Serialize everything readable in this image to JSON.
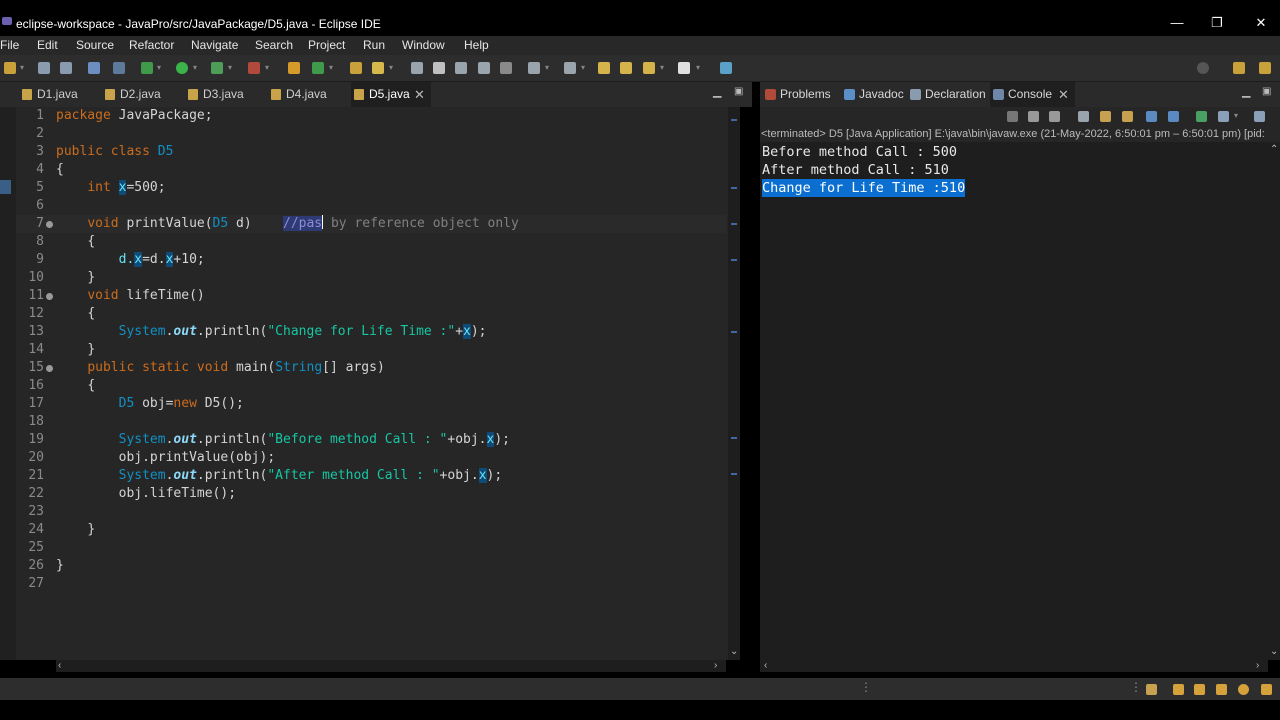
{
  "window": {
    "title": "eclipse-workspace - JavaPro/src/JavaPackage/D5.java - Eclipse IDE",
    "controls": {
      "minimize": "—",
      "maximize": "❐",
      "close": "✕"
    }
  },
  "menu": [
    "File",
    "Edit",
    "Source",
    "Refactor",
    "Navigate",
    "Search",
    "Project",
    "Run",
    "Window",
    "Help"
  ],
  "editor_tabs": [
    {
      "label": "D1.java",
      "active": false
    },
    {
      "label": "D2.java",
      "active": false
    },
    {
      "label": "D3.java",
      "active": false
    },
    {
      "label": "D4.java",
      "active": false
    },
    {
      "label": "D5.java",
      "active": true,
      "close": "✕"
    }
  ],
  "editor": {
    "line_numbers": [
      "1",
      "2",
      "3",
      "4",
      "5",
      "6",
      "7",
      "8",
      "9",
      "10",
      "11",
      "12",
      "13",
      "14",
      "15",
      "16",
      "17",
      "18",
      "19",
      "20",
      "21",
      "22",
      "23",
      "24",
      "25",
      "26",
      "27"
    ],
    "code": {
      "l1_kw": "package",
      "l1_rest": " JavaPackage;",
      "l3_kw1": "public",
      "l3_kw2": "class",
      "l3_name": "D5",
      "l4": "{",
      "l5_kw": "int",
      "l5_field": "x",
      "l5_rest": "=500;",
      "l7_kw": "void",
      "l7_m": " printValue(",
      "l7_type": "D5",
      "l7_param": " d)",
      "l7_comment_a": "//pas",
      "l7_comment_b": " by reference object only",
      "l8": "{",
      "l9_a": "d.",
      "l9_x1": "x",
      "l9_b": "=d.",
      "l9_x2": "x",
      "l9_c": "+10;",
      "l10": "}",
      "l11_kw": "void",
      "l11_rest": " lifeTime()",
      "l12": "{",
      "l13_sys": "System",
      "l13_dot": ".",
      "l13_out": "out",
      "l13_pr": ".println(",
      "l13_str": "\"Change for Life Time :\"",
      "l13_plus": "+",
      "l13_x": "x",
      "l13_end": ");",
      "l14": "}",
      "l15_kw1": "public",
      "l15_kw2": "static",
      "l15_kw3": "void",
      "l15_main": " main(",
      "l15_type": "String",
      "l15_rest": "[] args)",
      "l16": "{",
      "l17_type": "D5",
      "l17_a": " obj=",
      "l17_kw": "new",
      "l17_b": " D5();",
      "l19_sys": "System",
      "l19_dot": ".",
      "l19_out": "out",
      "l19_pr": ".println(",
      "l19_str": "\"Before method Call : \"",
      "l19_plus": "+obj.",
      "l19_x": "x",
      "l19_end": ");",
      "l20": "obj.printValue(obj);",
      "l21_sys": "System",
      "l21_dot": ".",
      "l21_out": "out",
      "l21_pr": ".println(",
      "l21_str": "\"After method Call : \"",
      "l21_plus": "+obj.",
      "l21_x": "x",
      "l21_end": ");",
      "l22": "obj.lifeTime();",
      "l24": "}",
      "l26": "}"
    }
  },
  "views": {
    "tabs": [
      {
        "label": "Problems",
        "icon": "problems-icon"
      },
      {
        "label": "Javadoc",
        "icon": "javadoc-icon"
      },
      {
        "label": "Declaration",
        "icon": "declaration-icon"
      },
      {
        "label": "Console",
        "icon": "console-icon",
        "active": true,
        "close": "✕"
      }
    ],
    "console_status": "<terminated> D5 [Java Application] E:\\java\\bin\\javaw.exe  (21-May-2022, 6:50:01 pm – 6:50:01 pm) [pid:",
    "console_output": [
      "Before method Call : 500",
      "After method Call : 510",
      "Change for Life Time :510"
    ]
  },
  "colors": {
    "keyword": "#cc6c1d",
    "type": "#1290c3",
    "string": "#17c6a3",
    "comment": "#808080",
    "selection": "#0a6fd1"
  }
}
